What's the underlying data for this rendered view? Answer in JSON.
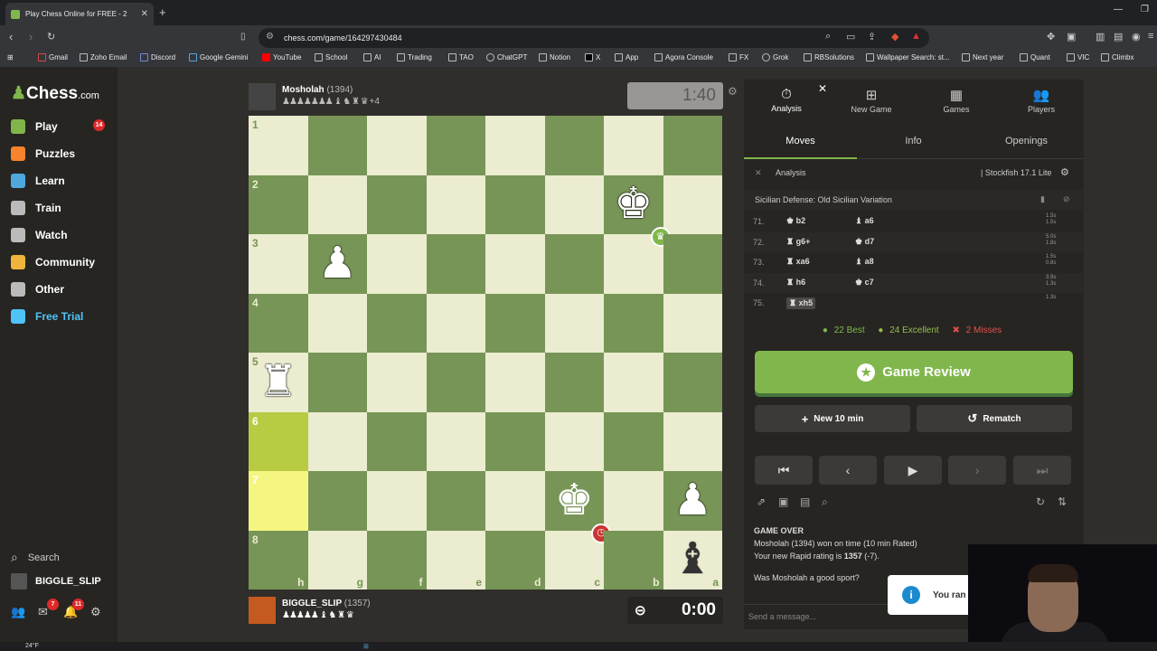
{
  "browser": {
    "tab_title": "Play Chess Online for FREE - 2",
    "url": "chess.com/game/164297430484",
    "bookmarks": [
      "Gmail",
      "Zoho Email",
      "Discord",
      "Google Gemini",
      "YouTube",
      "School",
      "AI",
      "Trading",
      "TAO",
      "ChatGPT",
      "Notion",
      "X",
      "App",
      "Agora Console",
      "FX",
      "Grok",
      "RBSolutions",
      "Wallpaper Search: st...",
      "Next year",
      "Quant",
      "VIC",
      "Climbx"
    ]
  },
  "sidebar": {
    "logo": "Chess",
    "logo_suffix": ".com",
    "items": [
      {
        "label": "Play",
        "icon": "play-icon",
        "color": "#81b64c"
      },
      {
        "label": "Puzzles",
        "icon": "puzzle-icon",
        "color": "#f7832a"
      },
      {
        "label": "Learn",
        "icon": "learn-icon",
        "color": "#4ea8de"
      },
      {
        "label": "Train",
        "icon": "train-icon",
        "color": "#bbbbbb"
      },
      {
        "label": "Watch",
        "icon": "watch-icon",
        "color": "#bbbbbb"
      },
      {
        "label": "Community",
        "icon": "community-icon",
        "color": "#f0b43c"
      },
      {
        "label": "Other",
        "icon": "more-icon",
        "color": "#bbbbbb"
      },
      {
        "label": "Free Trial",
        "icon": "diamond-icon",
        "color": "#4fc3f7"
      }
    ],
    "play_badge": "14",
    "search": "Search",
    "username": "BIGGLE_SLIP",
    "mail_badge": "7",
    "notif_badge": "11"
  },
  "top_player": {
    "name": "Mosholah",
    "rating": "(1394)",
    "captured": "♟♟♟♟♟♟♟ ♝ ♞ ♜ ♛",
    "advantage": "+4",
    "clock": "1:40"
  },
  "bottom_player": {
    "name": "BIGGLE_SLIP",
    "rating": "(1357)",
    "captured": "♟♟♟♟♟ ♝ ♞ ♜ ♛",
    "clock": "0:00"
  },
  "board": {
    "ranks": [
      "1",
      "2",
      "3",
      "4",
      "5",
      "6",
      "7",
      "8"
    ],
    "files": [
      "h",
      "g",
      "f",
      "e",
      "d",
      "c",
      "b",
      "a"
    ],
    "squares": [
      [
        "",
        "",
        "",
        "",
        "",
        "",
        "",
        ""
      ],
      [
        "",
        "",
        "",
        "",
        "",
        "",
        "♚",
        ""
      ],
      [
        "",
        "♟",
        "",
        "",
        "",
        "",
        "",
        ""
      ],
      [
        "",
        "",
        "",
        "",
        "",
        "",
        "",
        ""
      ],
      [
        "♜",
        "",
        "",
        "",
        "",
        "",
        "",
        ""
      ],
      [
        "",
        "",
        "",
        "",
        "",
        "",
        "",
        ""
      ],
      [
        "",
        "",
        "",
        "",
        "",
        "♚",
        "",
        "♟"
      ],
      [
        "",
        "",
        "",
        "",
        "",
        "",
        "",
        "♝"
      ]
    ],
    "colors": [
      [
        "",
        "",
        "",
        "",
        "",
        "",
        "",
        ""
      ],
      [
        "",
        "",
        "",
        "",
        "",
        "",
        "w",
        ""
      ],
      [
        "",
        "w",
        "",
        "",
        "",
        "",
        "",
        ""
      ],
      [
        "",
        "",
        "",
        "",
        "",
        "",
        "",
        ""
      ],
      [
        "w",
        "",
        "",
        "",
        "",
        "",
        "",
        ""
      ],
      [
        "",
        "",
        "",
        "",
        "",
        "",
        "",
        ""
      ],
      [
        "",
        "",
        "",
        "",
        "",
        "",
        "b",
        "w"
      ],
      [
        "",
        "",
        "",
        "",
        "",
        "",
        "",
        "b"
      ]
    ],
    "last_move": [
      "5-0",
      "6-0"
    ],
    "crown_square": "2-6",
    "timeout_square": "7-5",
    "light": "#ebecd0",
    "dark": "#779556"
  },
  "panel": {
    "tabs": [
      {
        "label": "Analysis",
        "icon": "stopwatch-icon"
      },
      {
        "label": "New Game",
        "icon": "plus-icon"
      },
      {
        "label": "Games",
        "icon": "board-icon"
      },
      {
        "label": "Players",
        "icon": "players-icon"
      }
    ],
    "subtabs": [
      "Moves",
      "Info",
      "Openings"
    ],
    "analysis_label": "Analysis",
    "engine": "Stockfish 17.1 Lite",
    "opening": "Sicilian Defense: Old Sicilian Variation",
    "moves": [
      {
        "n": "71.",
        "w": "♚ b2",
        "b": "♝ a6",
        "t": [
          "1.5s",
          "1.5s"
        ]
      },
      {
        "n": "72.",
        "w": "♜ g6+",
        "b": "♚ d7",
        "t": [
          "5.0s",
          "1.8s"
        ]
      },
      {
        "n": "73.",
        "w": "♜ xa6",
        "b": "♝ a8",
        "t": [
          "1.5s",
          "0.8s"
        ]
      },
      {
        "n": "74.",
        "w": "♜ h6",
        "b": "♚ c7",
        "t": [
          "3.9s",
          "1.3s"
        ]
      },
      {
        "n": "75.",
        "w": "♜ xh5",
        "b": "",
        "t": [
          "1.3s",
          ""
        ]
      }
    ],
    "stats": {
      "best": "22 Best",
      "excellent": "24 Excellent",
      "misses": "2 Misses"
    },
    "game_review": "Game Review",
    "new_game": "New 10 min",
    "rematch": "Rematch",
    "chat": {
      "header": "GAME OVER",
      "line1": "Mosholah (1394) won on time (10 min Rated)",
      "line2_pre": "Your new Rapid rating is ",
      "line2_val": "1357",
      "line2_post": " (-7).",
      "line3": "Was Mosholah a good sport?"
    },
    "message_placeholder": "Send a message...",
    "toast": "You ran"
  },
  "taskbar": {
    "weather": "24°F"
  }
}
